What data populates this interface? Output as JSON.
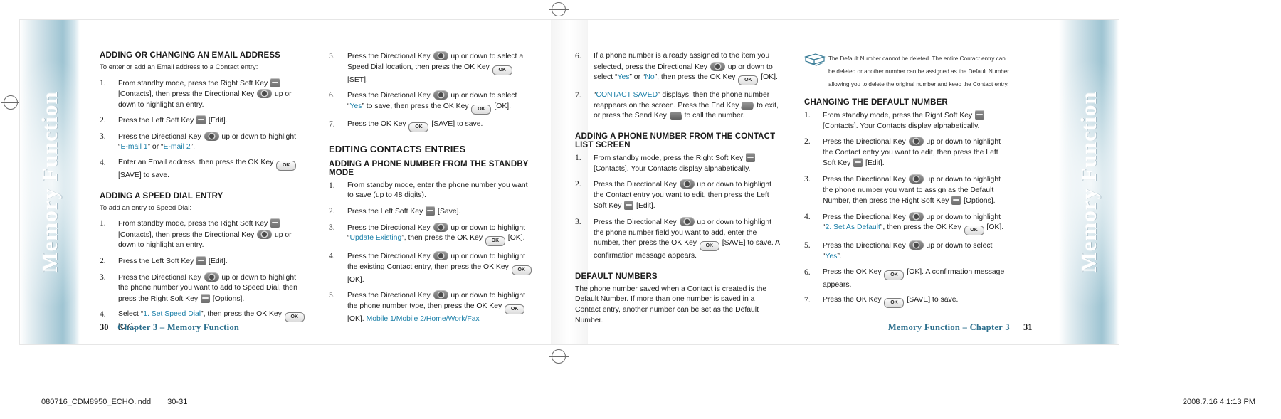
{
  "document": {
    "vertical_title": "Memory Function",
    "accent_color": "#1a7fa8",
    "chapter_color": "#2c6f8d"
  },
  "status_bar": {
    "file_name": "080716_CDM8950_ECHO.indd",
    "page_range": "30-31",
    "timestamp": "2008.7.16   4:1:13 PM"
  },
  "left_page": {
    "folio_number": "30",
    "folio_chapter": "Chapter 3 – Memory Function",
    "column1": {
      "section1_heading": "ADDING OR CHANGING AN EMAIL ADDRESS",
      "section1_lead": "To enter or add an Email address to a Contact entry:",
      "section1_steps": [
        {
          "num": "1.",
          "parts": [
            {
              "t": "From standby mode, press the Right Soft Key "
            },
            {
              "k": "soft"
            },
            {
              "t": " [Contacts], then press the Directional Key "
            },
            {
              "k": "dir"
            },
            {
              "t": " up or down to highlight an entry."
            }
          ]
        },
        {
          "num": "2.",
          "parts": [
            {
              "t": "Press the Left Soft Key "
            },
            {
              "k": "soft"
            },
            {
              "t": " [Edit]."
            }
          ]
        },
        {
          "num": "3.",
          "parts": [
            {
              "t": "Press the Directional Key "
            },
            {
              "k": "dir"
            },
            {
              "t": " up or down to highlight “"
            },
            {
              "hl": "E-mail 1"
            },
            {
              "t": "” or “"
            },
            {
              "hl": "E-mail 2"
            },
            {
              "t": "”."
            }
          ]
        },
        {
          "num": "4.",
          "parts": [
            {
              "t": "Enter an Email address, then press the OK Key "
            },
            {
              "k": "ok"
            },
            {
              "t": " [SAVE] to save."
            }
          ]
        }
      ],
      "section2_heading": "ADDING A SPEED DIAL ENTRY",
      "section2_lead": "To add an entry to Speed Dial:",
      "section2_steps": [
        {
          "num": "1.",
          "parts": [
            {
              "t": "From standby mode, press the Right Soft Key "
            },
            {
              "k": "soft"
            },
            {
              "t": " [Contacts], then press the Directional Key "
            },
            {
              "k": "dir"
            },
            {
              "t": " up or down to highlight an entry."
            }
          ]
        },
        {
          "num": "2.",
          "parts": [
            {
              "t": "Press the Left Soft Key "
            },
            {
              "k": "soft"
            },
            {
              "t": " [Edit]."
            }
          ]
        },
        {
          "num": "3.",
          "parts": [
            {
              "t": "Press the Directional Key "
            },
            {
              "k": "dir"
            },
            {
              "t": " up or down to highlight the phone number you want to add to Speed Dial, then press the Right Soft Key "
            },
            {
              "k": "soft"
            },
            {
              "t": " [Options]."
            }
          ]
        },
        {
          "num": "4.",
          "parts": [
            {
              "t": "Select “"
            },
            {
              "hl": "1. Set Speed Dial"
            },
            {
              "t": "”, then press the OK Key "
            },
            {
              "k": "ok"
            },
            {
              "t": " [OK]."
            }
          ]
        }
      ]
    },
    "column2": {
      "cont_steps": [
        {
          "num": "5.",
          "parts": [
            {
              "t": "Press the Directional Key "
            },
            {
              "k": "dir"
            },
            {
              "t": " up or down to select a Speed Dial location, then press the OK Key "
            },
            {
              "k": "ok"
            },
            {
              "t": " [SET]."
            }
          ]
        },
        {
          "num": "6.",
          "parts": [
            {
              "t": "Press the Directional Key "
            },
            {
              "k": "dir"
            },
            {
              "t": " up or down to select “"
            },
            {
              "hl": "Yes"
            },
            {
              "t": "” to save, then press the OK Key "
            },
            {
              "k": "ok"
            },
            {
              "t": " [OK]."
            }
          ]
        },
        {
          "num": "7.",
          "parts": [
            {
              "t": "Press the OK Key "
            },
            {
              "k": "ok"
            },
            {
              "t": " [SAVE] to save."
            }
          ]
        }
      ],
      "big_heading": "EDITING CONTACTS ENTRIES",
      "section_heading": "ADDING A PHONE NUMBER FROM THE STANDBY MODE",
      "steps": [
        {
          "num": "1.",
          "parts": [
            {
              "t": "From standby mode, enter the phone number you want to save (up to 48 digits)."
            }
          ]
        },
        {
          "num": "2.",
          "parts": [
            {
              "t": "Press the Left Soft Key "
            },
            {
              "k": "soft"
            },
            {
              "t": " [Save]."
            }
          ]
        },
        {
          "num": "3.",
          "parts": [
            {
              "t": "Press the Directional Key "
            },
            {
              "k": "dir"
            },
            {
              "t": " up or down to highlight “"
            },
            {
              "hl": "Update Existing"
            },
            {
              "t": "”, then press the OK Key "
            },
            {
              "k": "ok"
            },
            {
              "t": " [OK]."
            }
          ]
        },
        {
          "num": "4.",
          "parts": [
            {
              "t": "Press the Directional Key "
            },
            {
              "k": "dir"
            },
            {
              "t": " up or down to highlight the existing Contact entry, then press the OK Key "
            },
            {
              "k": "ok"
            },
            {
              "t": " [OK]."
            }
          ]
        },
        {
          "num": "5.",
          "parts": [
            {
              "t": "Press the Directional Key "
            },
            {
              "k": "dir"
            },
            {
              "t": " up or down to highlight the phone number type, then press the OK Key "
            },
            {
              "k": "ok"
            },
            {
              "t": " [OK]. "
            },
            {
              "hl": "Mobile 1/Mobile 2/Home/Work/Fax"
            }
          ]
        }
      ]
    }
  },
  "right_page": {
    "folio_number": "31",
    "folio_chapter": "Memory Function – Chapter 3",
    "column3": {
      "cont_steps": [
        {
          "num": "6.",
          "parts": [
            {
              "t": "If a phone number is already assigned to the item you selected, press the Directional Key "
            },
            {
              "k": "dir"
            },
            {
              "t": " up or down to select “"
            },
            {
              "hl": "Yes"
            },
            {
              "t": "” or “"
            },
            {
              "hl": "No"
            },
            {
              "t": "”, then press the OK Key "
            },
            {
              "k": "ok"
            },
            {
              "t": " [OK]."
            }
          ]
        },
        {
          "num": "7.",
          "parts": [
            {
              "t": "“"
            },
            {
              "hl": "CONTACT SAVED"
            },
            {
              "t": "” displays, then the phone number reappears on the screen. Press the End Key "
            },
            {
              "k": "end"
            },
            {
              "t": " to exit, or press the Send Key "
            },
            {
              "k": "send"
            },
            {
              "t": " to call the number."
            }
          ]
        }
      ],
      "section_heading": "ADDING A PHONE NUMBER FROM THE CONTACT LIST SCREEN",
      "steps": [
        {
          "num": "1.",
          "parts": [
            {
              "t": "From standby mode, press the Right Soft Key "
            },
            {
              "k": "soft"
            },
            {
              "t": " [Contacts]. Your Contacts display alphabetically."
            }
          ]
        },
        {
          "num": "2.",
          "parts": [
            {
              "t": "Press the Directional Key "
            },
            {
              "k": "dir"
            },
            {
              "t": " up or down to highlight the Contact entry you want to edit, then press the Left Soft Key "
            },
            {
              "k": "soft"
            },
            {
              "t": " [Edit]."
            }
          ]
        },
        {
          "num": "3.",
          "parts": [
            {
              "t": "Press the Directional Key "
            },
            {
              "k": "dir"
            },
            {
              "t": " up or down to highlight the phone number field you want to add, enter the number, then press the OK Key "
            },
            {
              "k": "ok"
            },
            {
              "t": " [SAVE] to save. A confirmation message appears."
            }
          ]
        }
      ],
      "default_heading": "DEFAULT NUMBERS",
      "default_body": "The phone number saved when a Contact is created is the Default Number. If more than one number is saved in a Contact entry, another number can be set as the Default Number."
    },
    "column4": {
      "note_text": "The Default Number cannot be deleted. The entire Contact entry can be deleted or another number can be assigned as the Default Number allowing you to delete the original number and keep the Contact entry.",
      "note_icon": "note-pages-icon",
      "section_heading": "CHANGING THE DEFAULT NUMBER",
      "steps": [
        {
          "num": "1.",
          "parts": [
            {
              "t": "From standby mode, press the Right Soft Key "
            },
            {
              "k": "soft"
            },
            {
              "t": " [Contacts]. Your Contacts display alphabetically."
            }
          ]
        },
        {
          "num": "2.",
          "parts": [
            {
              "t": "Press the Directional Key "
            },
            {
              "k": "dir"
            },
            {
              "t": " up or down to highlight the Contact entry you want to edit, then press the Left Soft Key "
            },
            {
              "k": "soft"
            },
            {
              "t": " [Edit]."
            }
          ]
        },
        {
          "num": "3.",
          "parts": [
            {
              "t": "Press the Directional Key "
            },
            {
              "k": "dir"
            },
            {
              "t": " up or down to highlight the phone number you want to assign as the Default Number, then press the Right Soft Key "
            },
            {
              "k": "soft"
            },
            {
              "t": " [Options]."
            }
          ]
        },
        {
          "num": "4.",
          "parts": [
            {
              "t": "Press the Directional Key "
            },
            {
              "k": "dir"
            },
            {
              "t": " up or down to highlight “"
            },
            {
              "hl": "2. Set As Default"
            },
            {
              "t": "”, then press the OK Key "
            },
            {
              "k": "ok"
            },
            {
              "t": " [OK]."
            }
          ]
        },
        {
          "num": "5.",
          "parts": [
            {
              "t": "Press the Directional Key "
            },
            {
              "k": "dir"
            },
            {
              "t": " up or down to select “"
            },
            {
              "hl": "Yes"
            },
            {
              "t": "”."
            }
          ]
        },
        {
          "num": "6.",
          "parts": [
            {
              "t": "Press the OK Key "
            },
            {
              "k": "ok"
            },
            {
              "t": " [OK]. A confirmation message appears."
            }
          ]
        },
        {
          "num": "7.",
          "parts": [
            {
              "t": "Press the OK Key "
            },
            {
              "k": "ok"
            },
            {
              "t": " [SAVE] to save."
            }
          ]
        }
      ]
    }
  },
  "ok_key_label": "OK"
}
